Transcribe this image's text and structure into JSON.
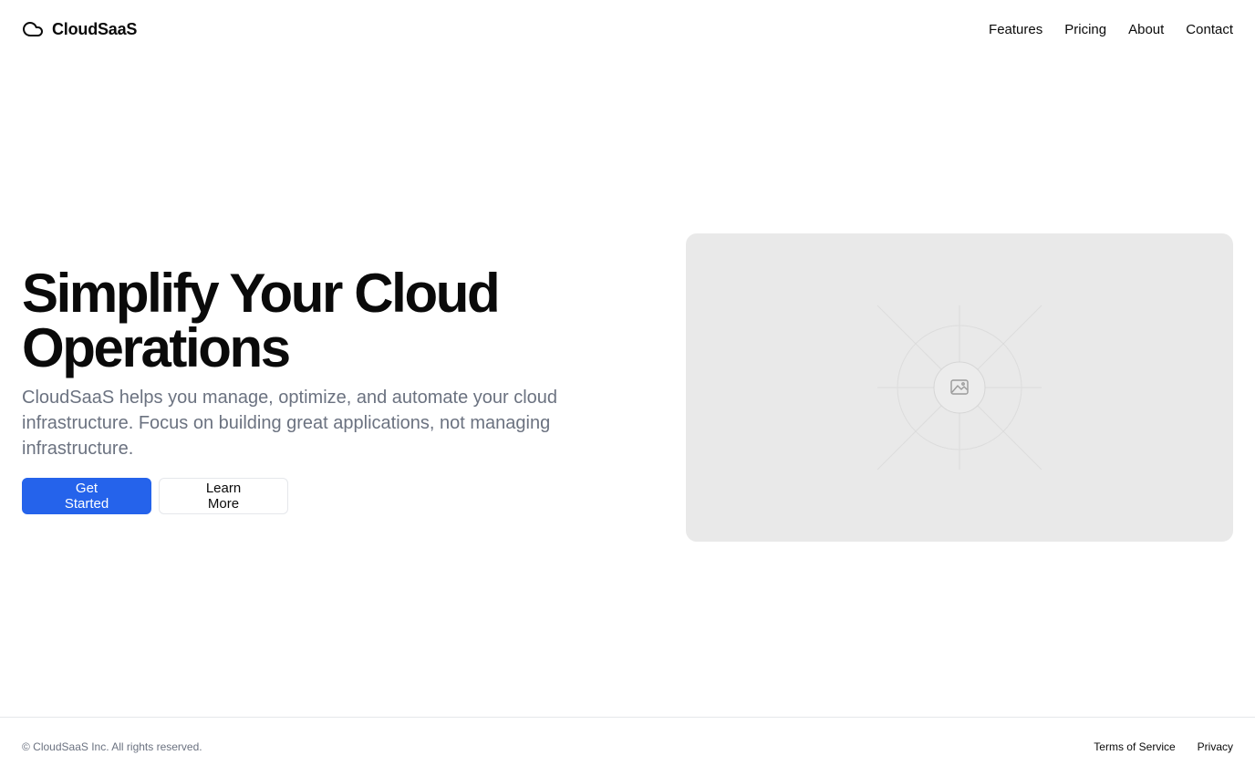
{
  "header": {
    "brand": "CloudSaaS",
    "brand_icon": "cloud-icon",
    "nav": [
      "Features",
      "Pricing",
      "About",
      "Contact"
    ]
  },
  "hero": {
    "headline_line1": "Simplify Your Cloud",
    "headline_line2": "Operations",
    "subtext": "CloudSaaS helps you manage, optimize, and automate your cloud infrastructure. Focus on building great applications, not managing infrastructure.",
    "primary_button": "Get Started",
    "secondary_button": "Learn More",
    "image_icon": "image-placeholder-icon"
  },
  "footer": {
    "copyright": "© CloudSaaS Inc. All rights reserved.",
    "links": [
      "Terms of Service",
      "Privacy"
    ]
  },
  "colors": {
    "primary": "#2563eb",
    "muted_text": "#6b7280",
    "placeholder_bg": "#e9e9e9",
    "border": "#e5e7eb"
  }
}
